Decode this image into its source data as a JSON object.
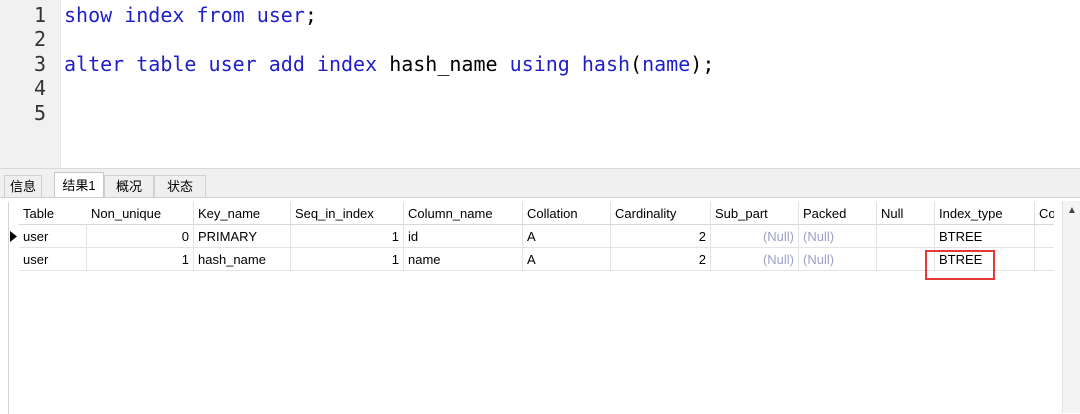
{
  "editor": {
    "line_numbers": [
      "1",
      "2",
      "3",
      "4",
      "5"
    ],
    "line1": {
      "kw1": "show",
      "kw2": "index",
      "kw3": "from",
      "table": "user",
      "end": ";"
    },
    "line3": {
      "kw1": "alter",
      "kw2": "table",
      "table": "user",
      "kw3": "add",
      "kw4": "index",
      "index_name": "hash_name",
      "kw5": "using",
      "kw6": "hash",
      "paren_open": "(",
      "column": "name",
      "paren_close": ")",
      "end": ";"
    }
  },
  "tabs": [
    "信息",
    "结果1",
    "概况",
    "状态"
  ],
  "grid": {
    "columns": [
      "Table",
      "Non_unique",
      "Key_name",
      "Seq_in_index",
      "Column_name",
      "Collation",
      "Cardinality",
      "Sub_part",
      "Packed",
      "Null",
      "Index_type",
      "Con"
    ],
    "rows": [
      [
        "user",
        "0",
        "PRIMARY",
        "1",
        "id",
        "A",
        "2",
        "(Null)",
        "(Null)",
        "",
        "BTREE",
        ""
      ],
      [
        "user",
        "1",
        "hash_name",
        "1",
        "name",
        "A",
        "2",
        "(Null)",
        "(Null)",
        "",
        "BTREE",
        ""
      ]
    ]
  },
  "icons": {
    "row_pointer": "current-row-arrow-icon",
    "scroll_up": "scroll-up-arrow-icon"
  },
  "colors": {
    "keyword": "#1f1fc8",
    "highlight": "#e53935",
    "null_text": "#9aa2c8"
  }
}
